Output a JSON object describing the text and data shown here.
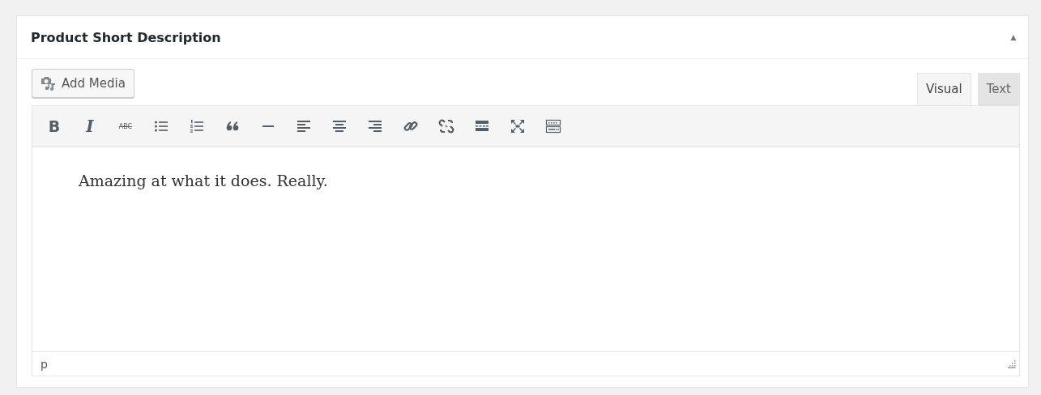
{
  "panel": {
    "title": "Product Short Description",
    "toggle": "▲",
    "expanded": true
  },
  "add_media": {
    "label": "Add Media"
  },
  "tabs": [
    {
      "label": "Visual",
      "selected": true
    },
    {
      "label": "Text",
      "selected": false
    }
  ],
  "toolbar": [
    {
      "kind": "bold",
      "label": "B"
    },
    {
      "kind": "italic",
      "label": "I"
    },
    {
      "kind": "strikethrough",
      "label": "ABC"
    },
    {
      "kind": "bullets"
    },
    {
      "kind": "numbers"
    },
    {
      "kind": "quote"
    },
    {
      "kind": "rule"
    },
    {
      "kind": "align-left"
    },
    {
      "kind": "align-center"
    },
    {
      "kind": "align-right"
    },
    {
      "kind": "link"
    },
    {
      "kind": "unlink"
    },
    {
      "kind": "more"
    },
    {
      "kind": "fullscreen"
    },
    {
      "kind": "keyboard"
    }
  ],
  "content": "Amazing at what it does. Really.",
  "status_bar": {
    "path": "p"
  }
}
